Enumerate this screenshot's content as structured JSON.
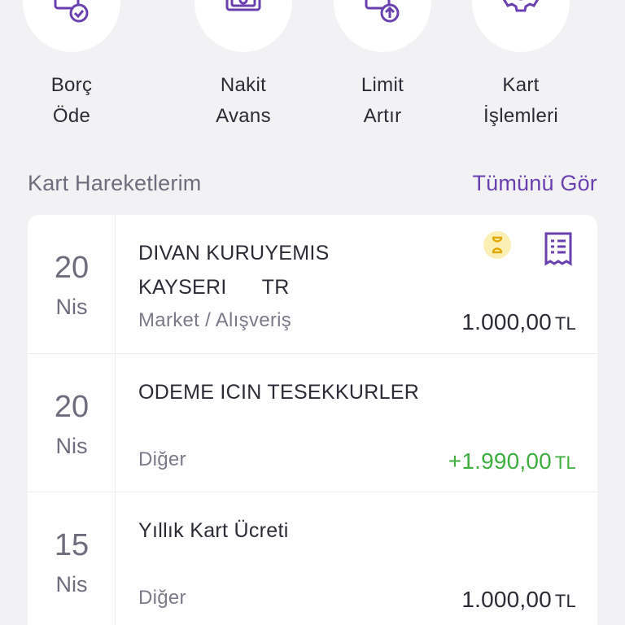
{
  "quick_actions": [
    {
      "id": "borc-ode",
      "line1": "Borç",
      "line2": "Öde",
      "icon": "card-check-icon"
    },
    {
      "id": "nakit-avans",
      "line1": "Nakit",
      "line2": "Avans",
      "icon": "cash-icon"
    },
    {
      "id": "limit-artir",
      "line1": "Limit",
      "line2": "Artır",
      "icon": "card-upload-icon"
    },
    {
      "id": "kart-islemleri",
      "line1": "Kart",
      "line2": "İşlemleri",
      "icon": "gear-icon"
    }
  ],
  "transactions_section": {
    "title": "Kart Hareketlerim",
    "see_all": "Tümünü Gör"
  },
  "transactions": [
    {
      "day": "20",
      "month": "Nis",
      "merchant_line1": "DIVAN KURUYEMIS",
      "merchant_line2": "KAYSERI      TR",
      "category": "Market / Alışveriş",
      "amount": "1.000,00",
      "currency": "TL",
      "positive": false,
      "pending": true,
      "receipt": true
    },
    {
      "day": "20",
      "month": "Nis",
      "merchant_line1": "ODEME ICIN TESEKKURLER",
      "merchant_line2": "",
      "category": "Diğer",
      "amount": "+1.990,00",
      "currency": "TL",
      "positive": true,
      "pending": false,
      "receipt": false
    },
    {
      "day": "15",
      "month": "Nis",
      "merchant_line1": "Yıllık Kart Ücreti",
      "merchant_line2": "",
      "category": "Diğer",
      "amount": "1.000,00",
      "currency": "TL",
      "positive": false,
      "pending": false,
      "receipt": false
    }
  ],
  "colors": {
    "accent": "#6a3fb0",
    "positive": "#3eae3e",
    "pending_bg": "#fbefb5",
    "pending_fg": "#e0a800"
  }
}
